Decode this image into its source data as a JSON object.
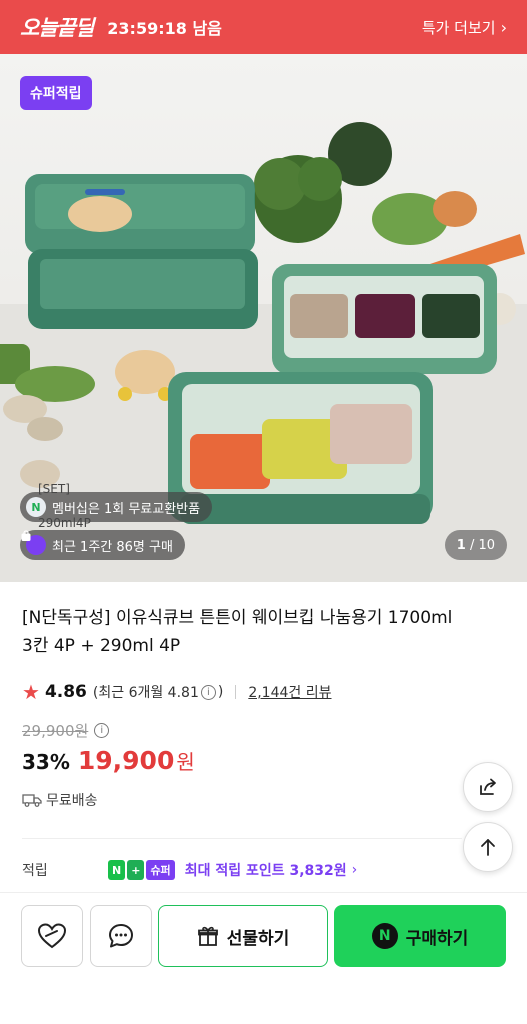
{
  "deal_bar": {
    "logo": "오늘끝딜",
    "timer": "23:59:18 남음",
    "more_label": "특가 더보기",
    "bg_color": "#ea4b4b"
  },
  "hero": {
    "badge": "슈퍼적립",
    "set_label_line1": "[SET]",
    "set_label_line2": "290ml4P",
    "pill_membership": "멤버십은 1회 무료교환반품",
    "pill_membership_icon": "N",
    "pill_recent": "최근 1주간 86명 구매",
    "pill_recent_icon": "bag-icon",
    "counter_current": "1",
    "counter_total": "/ 10"
  },
  "product": {
    "title": "[N단독구성] 이유식큐브 튼튼이 웨이브킵 나눔용기 1700ml 3칸 4P + 290ml 4P",
    "rating": "4.86",
    "recent_rating": "(최근 6개월 4.81",
    "recent_rating_close": ")",
    "review_count": "2,144건 리뷰",
    "original_price": "29,900원",
    "discount": "33%",
    "price": "19,900",
    "currency": "원",
    "shipping": "무료배송",
    "accent_color": "#e23b3b"
  },
  "points": {
    "label": "적립",
    "badge_n": "N",
    "badge_plus": "+",
    "badge_super": "슈퍼",
    "text": "최대 적립 포인트 3,832원",
    "color": "#7b3ff2"
  },
  "bottom": {
    "gift_label": "선물하기",
    "buy_label": "구매하기",
    "buy_icon": "N",
    "buy_color": "#1fd15a"
  }
}
